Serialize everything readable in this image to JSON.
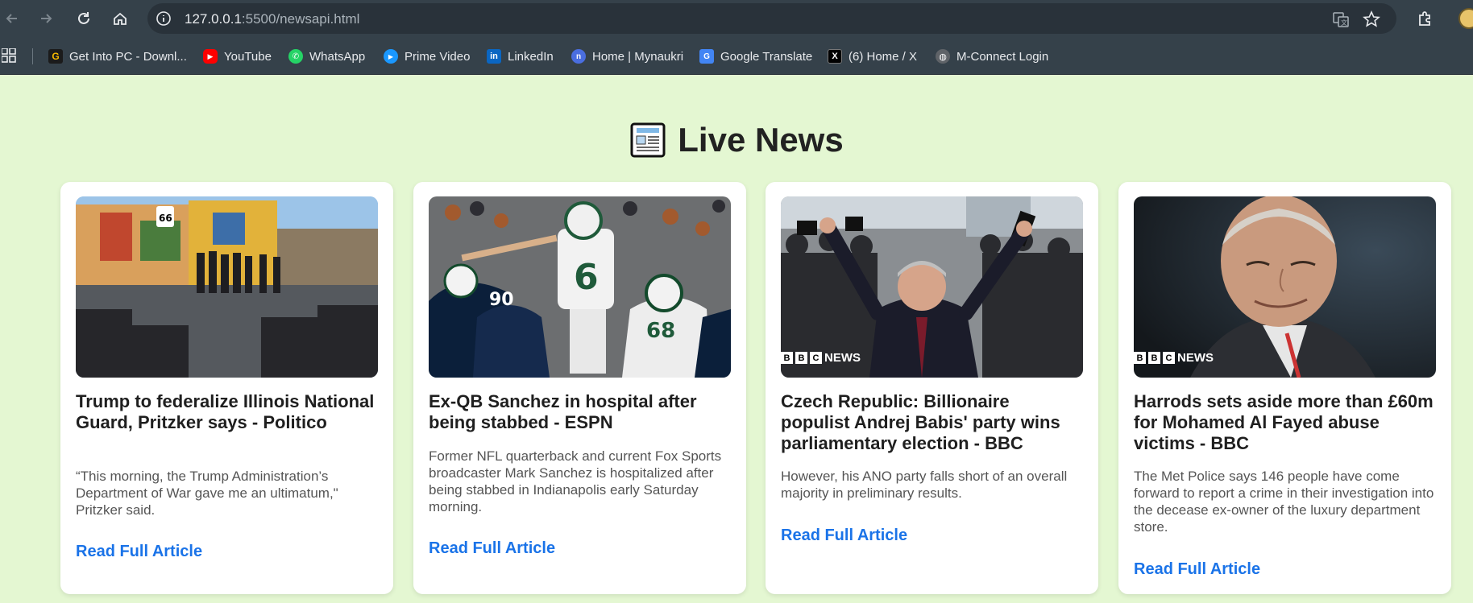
{
  "browser": {
    "url_host": "127.0.0.1",
    "url_path": ":5500/newsapi.html",
    "bookmarks": [
      {
        "label": "Get Into PC - Downl...",
        "icon": "getintopc-icon",
        "color": "#1b1b1b"
      },
      {
        "label": "YouTube",
        "icon": "youtube-icon",
        "color": "#ff0000"
      },
      {
        "label": "WhatsApp",
        "icon": "whatsapp-icon",
        "color": "#25d366"
      },
      {
        "label": "Prime Video",
        "icon": "prime-video-icon",
        "color": "#1a98ff"
      },
      {
        "label": "LinkedIn",
        "icon": "linkedin-icon",
        "color": "#0a66c2"
      },
      {
        "label": "Home | Mynaukri",
        "icon": "mynaukri-icon",
        "color": "#4a6ee0"
      },
      {
        "label": "Google Translate",
        "icon": "google-translate-icon",
        "color": "#4285f4"
      },
      {
        "label": "(6) Home / X",
        "icon": "x-icon",
        "color": "#000000"
      },
      {
        "label": "M-Connect Login",
        "icon": "globe-icon",
        "color": "#5f6368"
      }
    ]
  },
  "page": {
    "title": "Live News"
  },
  "articles": [
    {
      "title": "Trump to federalize Illinois National Guard, Pritzker says - Politico",
      "description": "“This morning, the Trump Administration’s Department of War gave me an ultimatum,\" Pritzker said.",
      "link_label": "Read Full Article"
    },
    {
      "title": "Ex-QB Sanchez in hospital after being stabbed - ESPN",
      "description": "Former NFL quarterback and current Fox Sports broadcaster Mark Sanchez is hospitalized after being stabbed in Indianapolis early Saturday morning.",
      "link_label": "Read Full Article"
    },
    {
      "title": "Czech Republic: Billionaire populist Andrej Babis' party wins parliamentary election - BBC",
      "description": "However, his ANO party falls short of an overall majority in preliminary results.",
      "link_label": "Read Full Article",
      "image_badge": "NEWS"
    },
    {
      "title": "Harrods sets aside more than £60m for Mohamed Al Fayed abuse victims - BBC",
      "description": "The Met Police says 146 people have come forward to report a crime in their investigation into the decease ex-owner of the luxury department store.",
      "link_label": "Read Full Article",
      "image_badge": "NEWS"
    }
  ],
  "colors": {
    "page_background": "#e4f7d2",
    "link": "#1a73e8",
    "chrome": "#35414a"
  }
}
